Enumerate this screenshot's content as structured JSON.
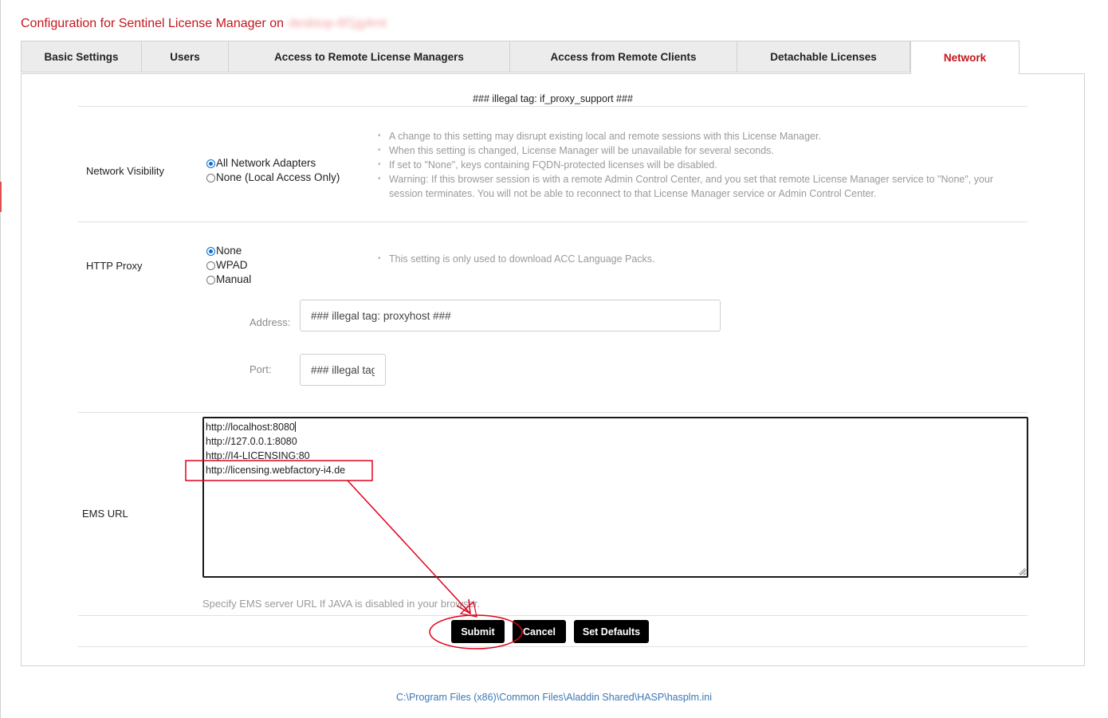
{
  "page": {
    "title": "Configuration for Sentinel License Manager on",
    "host": "desktop-6f1jg4mt"
  },
  "tabs": [
    {
      "label": "Basic Settings",
      "active": false
    },
    {
      "label": "Users",
      "active": false
    },
    {
      "label": "Access to Remote License Managers",
      "active": false
    },
    {
      "label": "Access from Remote Clients",
      "active": false
    },
    {
      "label": "Detachable Licenses",
      "active": false
    },
    {
      "label": "Network",
      "active": true
    }
  ],
  "network": {
    "illegal_tag_header": "### illegal tag: if_proxy_support ###",
    "visibility": {
      "label": "Network Visibility",
      "options": [
        {
          "label": "All Network Adapters",
          "checked": true
        },
        {
          "label": "None (Local Access Only)",
          "checked": false
        }
      ],
      "notes": [
        "A change to this setting may disrupt existing local and remote sessions with this License Manager.",
        "When this setting is changed, License Manager will be unavailable for several seconds.",
        "If set to \"None\", keys containing FQDN-protected licenses will be disabled.",
        "Warning: If this browser session is with a remote Admin Control Center, and you set that remote License Manager service to \"None\", your session terminates. You will not be able to reconnect to that License Manager service or Admin Control Center."
      ]
    },
    "proxy": {
      "label": "HTTP Proxy",
      "options": [
        {
          "label": "None",
          "checked": true
        },
        {
          "label": "WPAD",
          "checked": false
        },
        {
          "label": "Manual",
          "checked": false
        }
      ],
      "notes": [
        "This setting is only used to download ACC Language Packs."
      ],
      "address_label": "Address:",
      "address_value": "### illegal tag: proxyhost ###",
      "port_label": "Port:",
      "port_value": "### illegal tag: proxyport ###"
    },
    "ems": {
      "label": "EMS URL",
      "lines": [
        "http://localhost:8080",
        "http://127.0.0.1:8080",
        "http://I4-LICENSING:80",
        "http://licensing.webfactory-i4.de"
      ],
      "hint": "Specify EMS server URL If JAVA is disabled in your browser."
    },
    "buttons": {
      "submit": "Submit",
      "cancel": "Cancel",
      "defaults": "Set Defaults"
    }
  },
  "footer": {
    "path": "C:\\Program Files (x86)\\Common Files\\Aladdin Shared\\HASP\\hasplm.ini"
  },
  "annotations": {
    "color": "#e0001b"
  }
}
